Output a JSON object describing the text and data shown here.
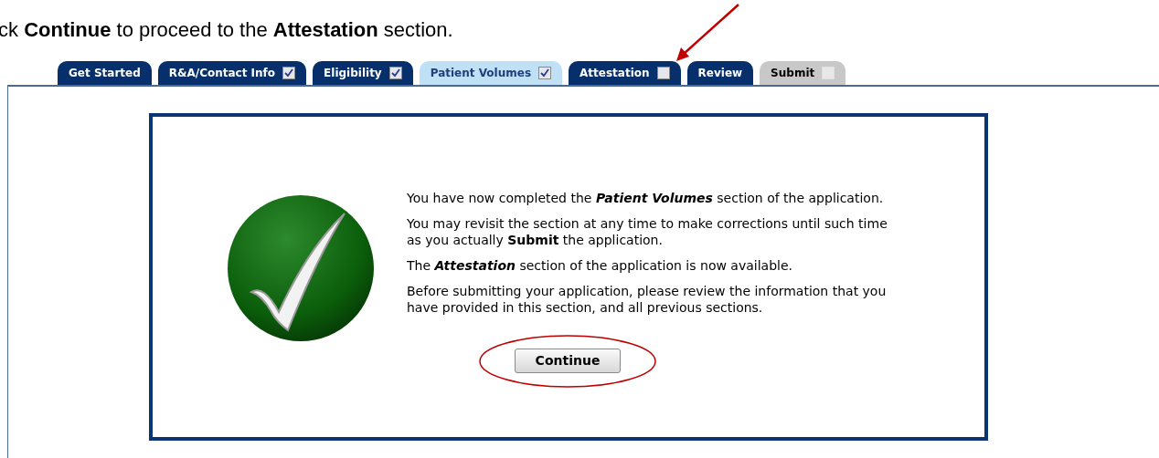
{
  "instruction": "ck **Continue** to proceed to the **Attestation** section.",
  "tabs": [
    {
      "label": "Get Started",
      "kind": "plain",
      "selected": false,
      "disabled": false
    },
    {
      "label": "R&A/Contact Info",
      "kind": "checkbox",
      "checked": true,
      "selected": false,
      "disabled": false
    },
    {
      "label": "Eligibility",
      "kind": "checkbox",
      "checked": true,
      "selected": false,
      "disabled": false
    },
    {
      "label": "Patient Volumes",
      "kind": "checkbox",
      "checked": true,
      "selected": true,
      "disabled": false
    },
    {
      "label": "Attestation",
      "kind": "checkbox",
      "checked": false,
      "selected": false,
      "disabled": false
    },
    {
      "label": "Review",
      "kind": "plain",
      "selected": false,
      "disabled": false
    },
    {
      "label": "Submit",
      "kind": "checkbox",
      "checked": false,
      "selected": false,
      "disabled": true
    }
  ],
  "dialog": {
    "paragraphs": [
      "You have now completed the *Patient Volumes* section of the application.",
      "You may revisit the section at any time to make corrections until such time as you actually **Submit** the application.",
      "The *Attestation* section of the application is now available.",
      "Before submitting your application, please review the information that you have provided in this section, and all previous sections."
    ],
    "button": "Continue"
  }
}
